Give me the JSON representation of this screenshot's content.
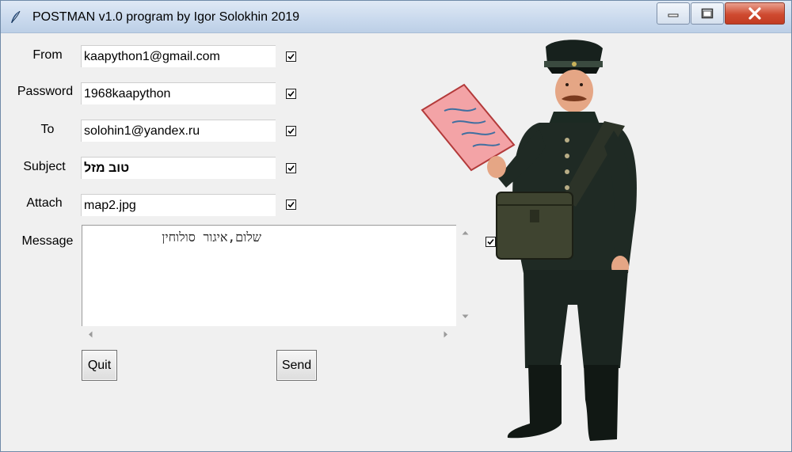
{
  "window": {
    "title": "POSTMAN v1.0 program by Igor Solokhin  2019",
    "app_icon": "feather-pen-icon",
    "controls": [
      "minimize-icon",
      "maximize-icon",
      "close-icon"
    ]
  },
  "form": {
    "from_label": "From",
    "from_value": "kaapython1@gmail.com",
    "password_label": "Password",
    "password_value": "1968kaapython",
    "to_label": "To",
    "to_value": "solohin1@yandex.ru",
    "subject_label": "Subject",
    "subject_value": "טוב מזל",
    "attach_label": "Attach",
    "attach_value": "map2.jpg",
    "message_label": "Message",
    "message_value": "שלום,איגור סולוחין"
  },
  "checkboxes": {
    "from": true,
    "password": true,
    "to": true,
    "subject": true,
    "attach": true,
    "message": true
  },
  "buttons": {
    "quit_label": "Quit",
    "send_label": "Send"
  },
  "illustration": {
    "subject": "postman-illustration",
    "colors": {
      "uniform": "#1f2a24",
      "bag": "#3f4430",
      "letter": "#f3a3a6"
    }
  }
}
